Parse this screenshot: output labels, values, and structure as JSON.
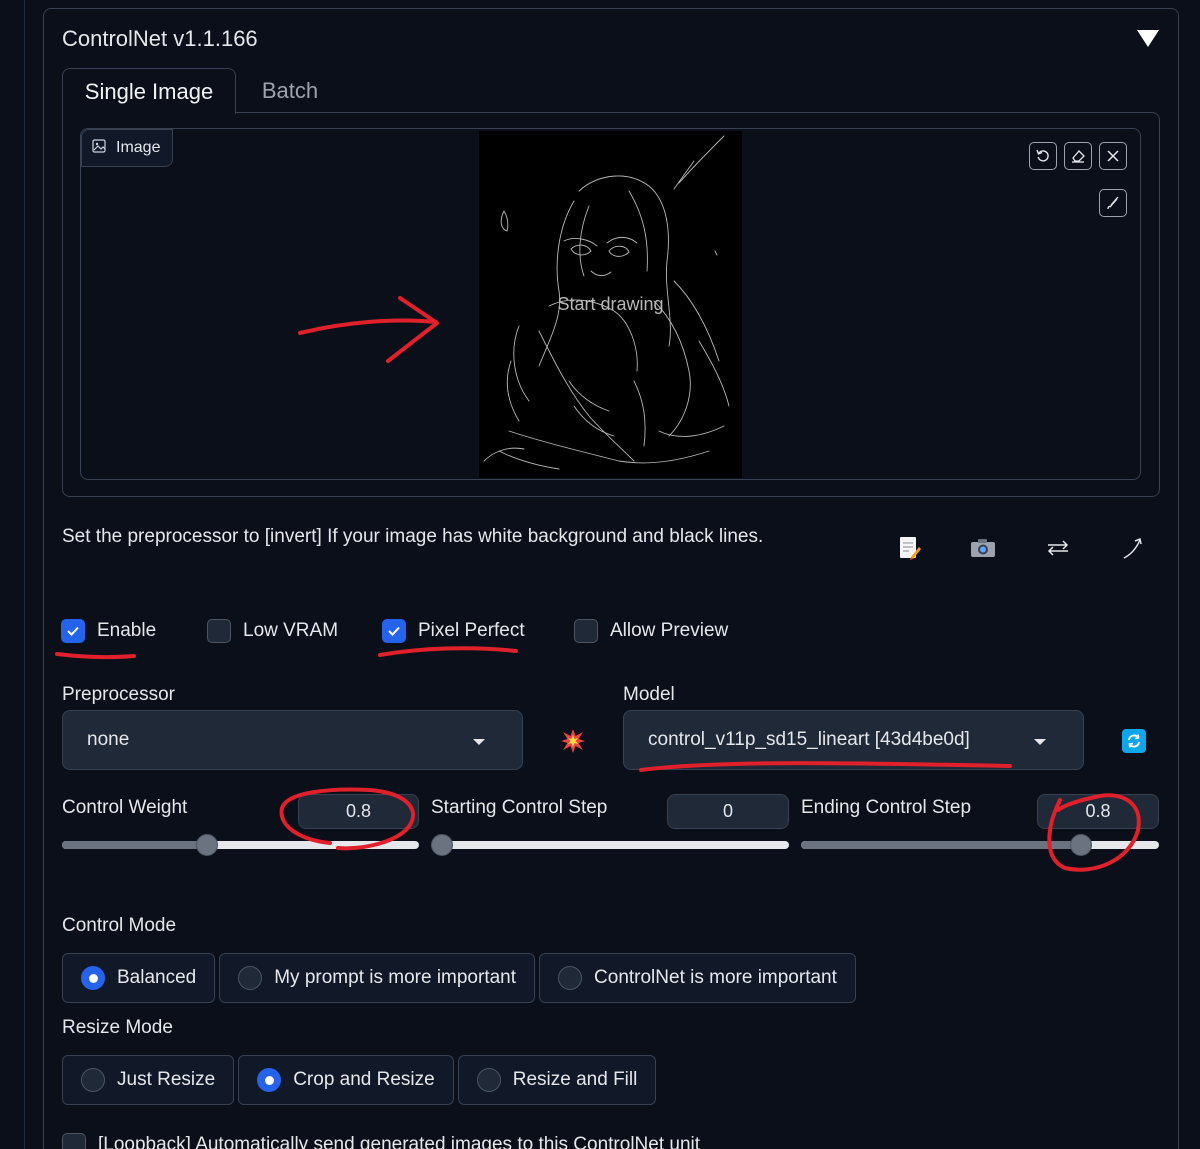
{
  "panel": {
    "title": "ControlNet v1.1.166"
  },
  "tabs": [
    {
      "label": "Single Image",
      "active": true
    },
    {
      "label": "Batch",
      "active": false
    }
  ],
  "image_input": {
    "label": "Image",
    "canvas_hint": "Start drawing",
    "tools": [
      "undo-icon",
      "eraser-icon",
      "close-icon",
      "brush-icon"
    ]
  },
  "hint_text": "Set the preprocessor to [invert] If your image has white background and black lines.",
  "action_icons": [
    "notepad-icon",
    "camera-icon",
    "swap-arrows-icon",
    "curved-arrow-icon"
  ],
  "checkboxes": [
    {
      "label": "Enable",
      "checked": true
    },
    {
      "label": "Low VRAM",
      "checked": false
    },
    {
      "label": "Pixel Perfect",
      "checked": true
    },
    {
      "label": "Allow Preview",
      "checked": false
    }
  ],
  "preprocessor": {
    "label": "Preprocessor",
    "value": "none"
  },
  "model": {
    "label": "Model",
    "value": "control_v11p_sd15_lineart [43d4be0d]"
  },
  "sliders": [
    {
      "label": "Control Weight",
      "value": "0.8",
      "fraction": 0.4
    },
    {
      "label": "Starting Control Step",
      "value": "0",
      "fraction": 0.0
    },
    {
      "label": "Ending Control Step",
      "value": "0.8",
      "fraction": 0.8
    }
  ],
  "control_mode": {
    "label": "Control Mode",
    "options": [
      "Balanced",
      "My prompt is more important",
      "ControlNet is more important"
    ],
    "selected": "Balanced"
  },
  "resize_mode": {
    "label": "Resize Mode",
    "options": [
      "Just Resize",
      "Crop and Resize",
      "Resize and Fill"
    ],
    "selected": "Crop and Resize"
  },
  "loopback": {
    "label": "[Loopback] Automatically send generated images to this ControlNet unit",
    "checked": false
  },
  "colors": {
    "background": "#0b0f19",
    "accent": "#2563eb",
    "annotation": "#e0202a"
  }
}
